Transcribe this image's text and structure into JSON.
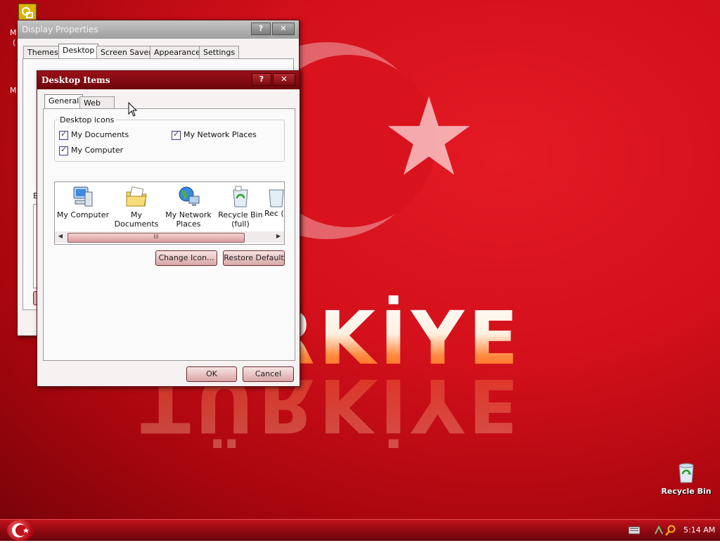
{
  "desktop": {
    "banner_text": "TÜRKİYE",
    "recycle_bin_label": "Recycle Bin",
    "left_partial_letters": [
      "M",
      "(",
      "M",
      "B"
    ]
  },
  "display_properties": {
    "title": "Display Properties",
    "help_btn": "?",
    "close_btn": "✕",
    "tabs": [
      "Themes",
      "Desktop",
      "Screen Saver",
      "Appearance",
      "Settings"
    ],
    "selected_tab": "Desktop"
  },
  "desktop_items": {
    "title": "Desktop Items",
    "help_btn": "?",
    "close_btn": "✕",
    "tabs": [
      "General",
      "Web"
    ],
    "selected_tab": "General",
    "group_label": "Desktop icons",
    "checkboxes": [
      {
        "label": "My Documents",
        "checked": true
      },
      {
        "label": "My Network Places",
        "checked": true
      },
      {
        "label": "My Computer",
        "checked": true
      }
    ],
    "icons": [
      {
        "label": "My Computer",
        "icon": "my-computer-icon"
      },
      {
        "label": "My Documents",
        "icon": "my-documents-icon"
      },
      {
        "label": "My Network Places",
        "icon": "network-places-icon"
      },
      {
        "label": "Recycle Bin (full)",
        "icon": "recycle-bin-full-icon"
      },
      {
        "label": "Rec (e",
        "icon": "recycle-bin-empty-icon"
      }
    ],
    "scroll_thumb_text": "III",
    "change_icon_btn": "Change Icon...",
    "restore_default_btn": "Restore Default",
    "ok_btn": "OK",
    "cancel_btn": "Cancel"
  },
  "taskbar": {
    "clock": "5:14 AM"
  },
  "colors": {
    "flag_red": "#d3101b",
    "title_active": "#8a0c14",
    "button_face": "#e6bdbd"
  }
}
